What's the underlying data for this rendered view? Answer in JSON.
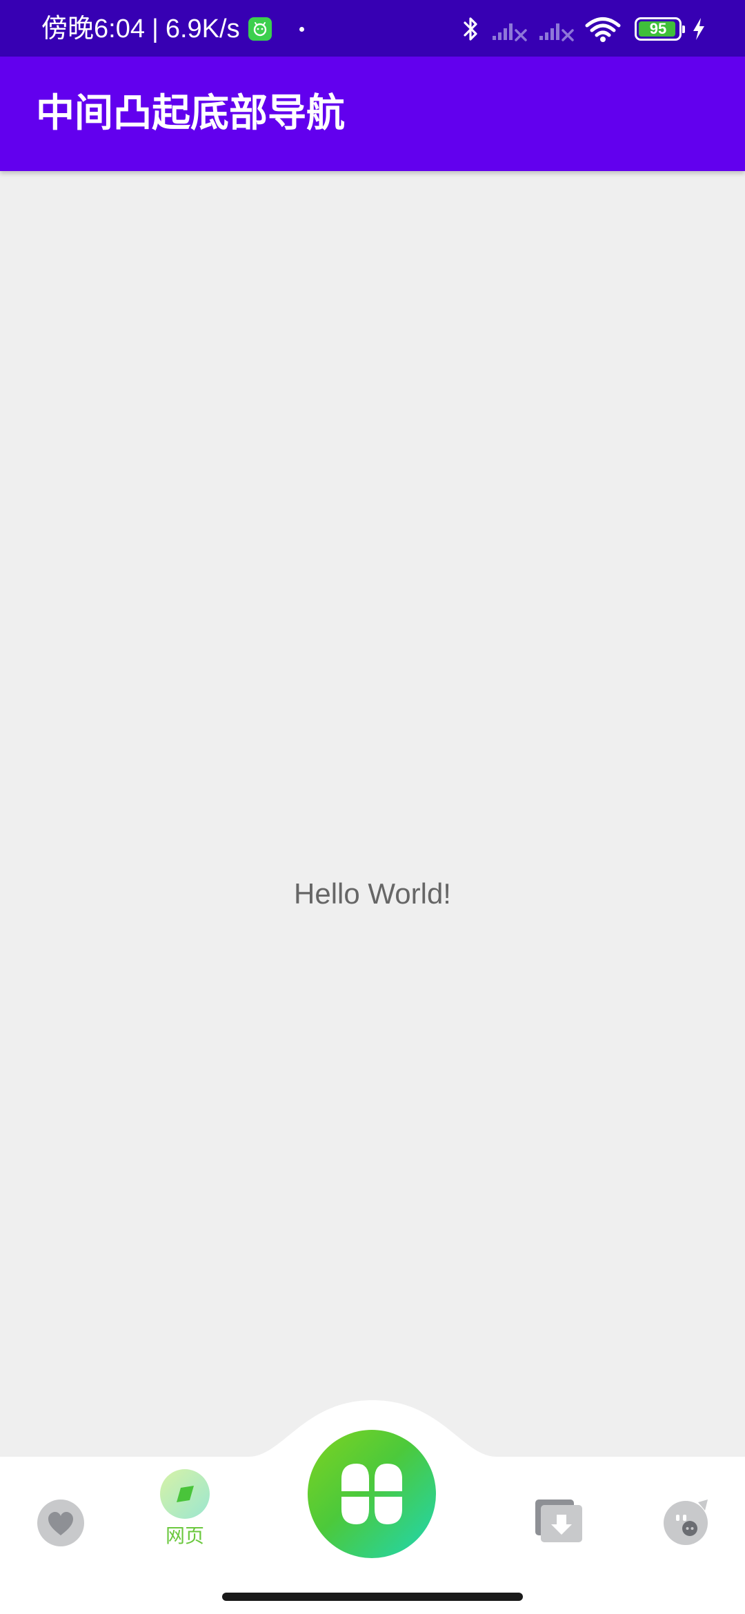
{
  "status_bar": {
    "time": "傍晚6:04",
    "separator": "|",
    "network_speed": "6.9K/s",
    "battery_level": "95",
    "battery_fraction": 0.95,
    "icons": [
      "app-notification-icon",
      "bluetooth-icon",
      "signal-no-service-icon",
      "signal-no-service-icon",
      "wifi-icon",
      "battery-icon",
      "charging-icon"
    ]
  },
  "app_bar": {
    "title": "中间凸起底部导航"
  },
  "content": {
    "text": "Hello World!"
  },
  "bottom_nav": {
    "items": [
      {
        "label": "",
        "icon": "heart-icon",
        "selected": false
      },
      {
        "label": "网页",
        "icon": "webpage-leaf-icon",
        "selected": true
      },
      {
        "label": "",
        "icon": "clover-icon",
        "selected": false
      },
      {
        "label": "",
        "icon": "download-folder-icon",
        "selected": false
      },
      {
        "label": "",
        "icon": "pig-face-icon",
        "selected": false
      }
    ]
  },
  "colors": {
    "status_bar": "#3700b3",
    "app_bar": "#6200ee",
    "background": "#efefef",
    "nav_selected": "#6bc83e",
    "nav_inactive_icon": "#c8c9cb",
    "fab_gradient_start": "#7ed321",
    "fab_gradient_end": "#1fd6b4"
  }
}
